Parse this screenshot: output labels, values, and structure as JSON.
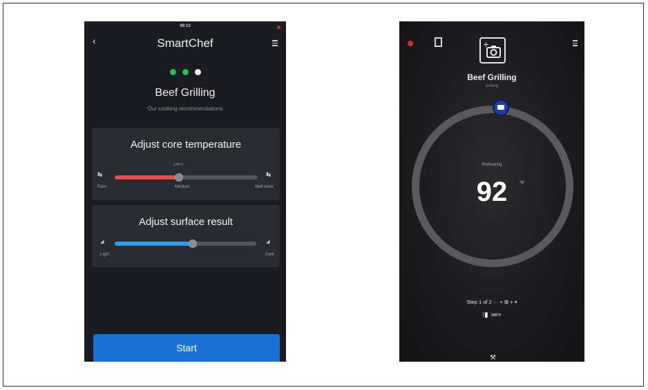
{
  "left_screen": {
    "status_time": "08:13",
    "app_title": "SmartChef",
    "progress_dots": [
      "#22c24d",
      "#22c24d",
      "#ffffff"
    ],
    "recipe_title": "Beef Grilling",
    "recipe_subtitle": "Our cooking recommendations",
    "core_temperature": {
      "title": "Adjust core temperature",
      "value_label": "140°F",
      "level": 0.45,
      "fill_color": "#e84a4e",
      "min_label": "Rare",
      "mid_label": "Medium",
      "max_label": "Well done"
    },
    "surface_result": {
      "title": "Adjust surface result",
      "level": 0.55,
      "fill_color": "#2d9ee8",
      "min_label": "Light",
      "max_label": "Dark"
    },
    "start_button": "Start"
  },
  "right_screen": {
    "dish_title": "Beef Grilling",
    "dish_subtitle": "Grilling",
    "phase": "Preheating",
    "temperature": "92",
    "temperature_unit": "°F",
    "step_text": "Step 1 of 2 ··· + ⊞ + ⏸",
    "target_value": "165°F",
    "icons": {
      "record": "record-dot-icon",
      "pause": "pause-square-icon",
      "menu": "menu-icon",
      "camera": "add-camera-icon",
      "ring_badge": "message-badge-icon",
      "thermometer": "thermometer-icon",
      "bottom": "tools-icon"
    }
  },
  "accent_colors": {
    "primary": "#1a73d2",
    "ring": "#5a5a5e",
    "badge": "#1e3fa8",
    "alert": "#e0252f"
  }
}
